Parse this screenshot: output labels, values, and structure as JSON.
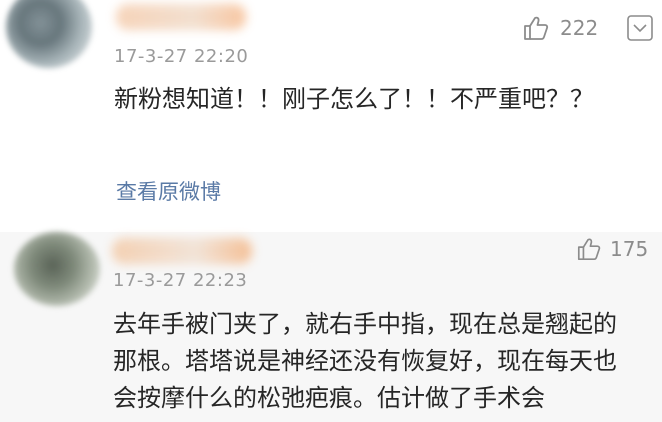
{
  "comments": [
    {
      "time": "17-3-27 22:20",
      "likes": "222",
      "text": "新粉想知道！！刚子怎么了！！不严重吧？？",
      "view_original": "查看原微博"
    },
    {
      "time": "17-3-27 22:23",
      "likes": "175",
      "text": "去年手被门夹了，就右手中指，现在总是翘起的那根。塔塔说是神经还没有恢复好，现在每天也会按摩什么的松弛疤痕。估计做了手术会"
    }
  ],
  "icons": {
    "like": "thumbs-up-icon",
    "more": "chevron-down-icon",
    "avatar": "blurred-avatar"
  },
  "colors": {
    "link": "#5a7aa6",
    "meta": "#9a9a9a",
    "text": "#262626",
    "second_bg": "#f7f7f7"
  }
}
